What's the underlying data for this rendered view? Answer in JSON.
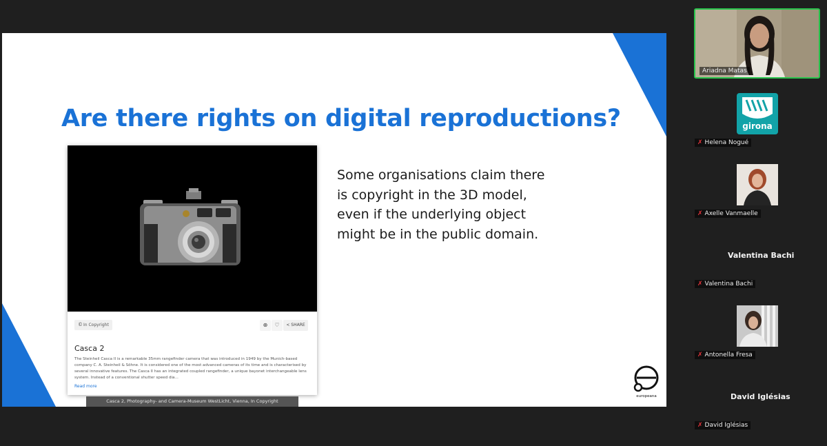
{
  "slide": {
    "title": "Are there rights on digital reproductions?",
    "body": "Some organisations claim there is copyright in the 3D model, even if the underlying object might be in the public domain.",
    "card": {
      "rights_label": "In Copyright",
      "share_label": "SHARE",
      "title": "Casca 2",
      "description": "The Steinheil Casca II is a remarkable 35mm rangefinder camera that was introduced in 1949 by the Munich-based company C. A. Steinheil & Söhne. It is considered one of the most advanced cameras of its time and is characterised by several innovative features. The Casca II has an integrated coupled rangefinder, a unique bayonet interchangeable lens system. Instead of a conventional shutter speed dia...",
      "read_more": "Read more"
    },
    "caption": "Casca 2, Photography- and Camera-Museum WestLicht, Vienna, In Copyright",
    "logo_text": "europeana",
    "colors": {
      "accent": "#1a72d6"
    }
  },
  "participants": {
    "active_speaker": {
      "name": "Ariadna Matas"
    },
    "list": [
      {
        "name": "Helena Nogué",
        "avatar_text": "girona",
        "muted": true
      },
      {
        "name": "Axelle Vanmaelle",
        "muted": true
      },
      {
        "name": "Valentina Bachi",
        "display_name": "Valentina Bachi",
        "muted": true
      },
      {
        "name": "Antonella Fresa",
        "muted": true
      },
      {
        "name": "David Iglésias",
        "display_name": "David Iglésias",
        "muted": true
      }
    ],
    "status_colors": {
      "speaking": "#27c34b",
      "muted": "#e8333a"
    }
  }
}
